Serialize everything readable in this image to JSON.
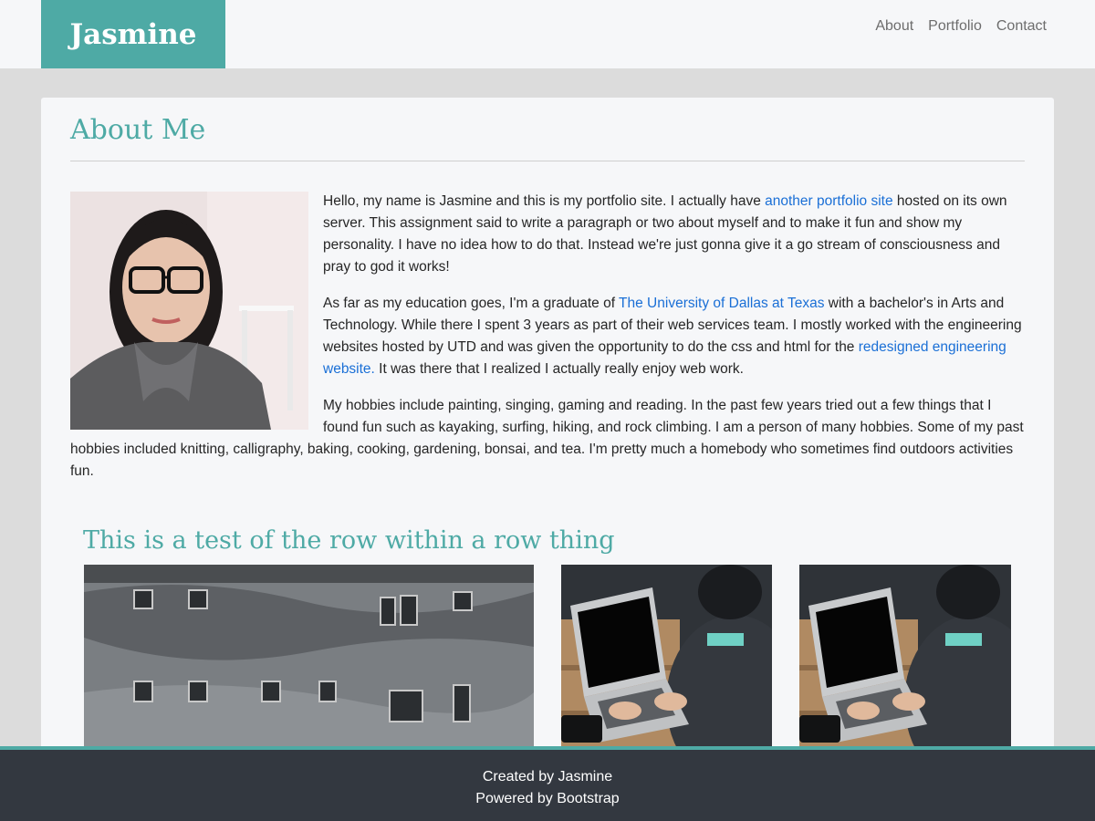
{
  "header": {
    "brand": "Jasmine",
    "nav": [
      {
        "label": "About"
      },
      {
        "label": "Portfolio"
      },
      {
        "label": "Contact"
      }
    ]
  },
  "about": {
    "title": "About Me",
    "p1": {
      "before": "Hello, my name is Jasmine and this is my portfolio site. I actually have ",
      "link": "another portfolio site",
      "after": " hosted on its own server. This assignment said to write a paragraph or two about myself and to make it fun and show my personality. I have no idea how to do that. Instead we're just gonna give it a go stream of consciousness and pray to god it works!"
    },
    "p2": {
      "before": "As far as my education goes, I'm a graduate of ",
      "link1": "The University of Dallas at Texas",
      "middle": " with a bachelor's in Arts and Technology. While there I spent 3 years as part of their web services team. I mostly worked with the engineering websites hosted by UTD and was given the opportunity to do the css and html for the ",
      "link2": "redesigned engineering website.",
      "after": " It was there that I realized I actually really enjoy web work."
    },
    "p3": "My hobbies include painting, singing, gaming and reading. In the past few years tried out a few things that I found fun such as kayaking, surfing, hiking, and rock climbing. I am a person of many hobbies. Some of my past hobbies included knitting, calligraphy, baking, cooking, gardening, bonsai, and tea. I'm pretty much a homebody who sometimes find outdoors activities fun."
  },
  "row_section": {
    "title": "This is a test of the row within a row thing"
  },
  "footer": {
    "line1": "Created by Jasmine",
    "line2": "Powered by Bootstrap"
  },
  "colors": {
    "accent": "#4eaaa5",
    "link": "#1a6fd6",
    "footer_bg": "#333840",
    "page_bg": "#dcdcdc"
  }
}
